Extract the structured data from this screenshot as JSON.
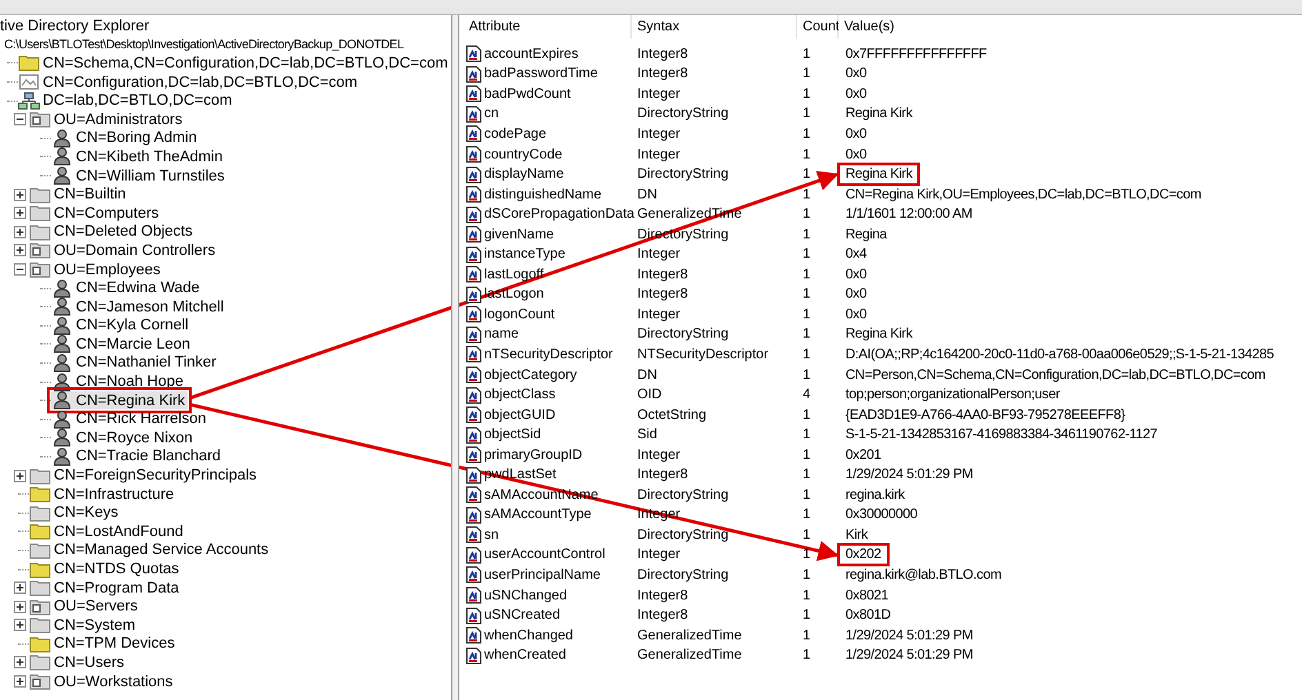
{
  "tree": {
    "label": "tive Directory Explorer",
    "children": [
      {
        "label": "C:\\Users\\BTLOTest\\Desktop\\Investigation\\ActiveDirectoryBackup_DONOTDEL",
        "children": [
          {
            "label": "CN=Schema,CN=Configuration,DC=lab,DC=BTLO,DC=com",
            "kind": "folder-yellow",
            "selected": false
          },
          {
            "label": "CN=Configuration,DC=lab,DC=BTLO,DC=com",
            "kind": "config",
            "selected": false
          },
          {
            "label": "DC=lab,DC=BTLO,DC=com",
            "kind": "domain",
            "selected": false,
            "children": [
              {
                "label": "OU=Administrators",
                "kind": "ou",
                "expanded": true,
                "selected": false,
                "children": [
                  {
                    "label": "CN=Boring Admin",
                    "kind": "user",
                    "selected": false
                  },
                  {
                    "label": "CN=Kibeth TheAdmin",
                    "kind": "user",
                    "selected": false
                  },
                  {
                    "label": "CN=William Turnstiles",
                    "kind": "user",
                    "selected": false
                  }
                ]
              },
              {
                "label": "CN=Builtin",
                "kind": "folder",
                "expanded": false,
                "selected": false
              },
              {
                "label": "CN=Computers",
                "kind": "folder",
                "expanded": false,
                "selected": false
              },
              {
                "label": "CN=Deleted Objects",
                "kind": "folder",
                "expanded": false,
                "selected": false
              },
              {
                "label": "OU=Domain Controllers",
                "kind": "ou",
                "expanded": false,
                "selected": false
              },
              {
                "label": "OU=Employees",
                "kind": "ou",
                "expanded": true,
                "selected": false,
                "children": [
                  {
                    "label": "CN=Edwina Wade",
                    "kind": "user",
                    "selected": false
                  },
                  {
                    "label": "CN=Jameson Mitchell",
                    "kind": "user",
                    "selected": false
                  },
                  {
                    "label": "CN=Kyla Cornell",
                    "kind": "user",
                    "selected": false
                  },
                  {
                    "label": "CN=Marcie Leon",
                    "kind": "user",
                    "selected": false
                  },
                  {
                    "label": "CN=Nathaniel Tinker",
                    "kind": "user",
                    "selected": false
                  },
                  {
                    "label": "CN=Noah Hope",
                    "kind": "user",
                    "selected": false
                  },
                  {
                    "label": "CN=Regina Kirk",
                    "kind": "user",
                    "selected": true,
                    "highlighted": true
                  },
                  {
                    "label": "CN=Rick Harrelson",
                    "kind": "user",
                    "selected": false
                  },
                  {
                    "label": "CN=Royce Nixon",
                    "kind": "user",
                    "selected": false
                  },
                  {
                    "label": "CN=Tracie Blanchard",
                    "kind": "user",
                    "selected": false
                  }
                ]
              },
              {
                "label": "CN=ForeignSecurityPrincipals",
                "kind": "folder",
                "expanded": false,
                "selected": false
              },
              {
                "label": "CN=Infrastructure",
                "kind": "folder-yellow",
                "selected": false
              },
              {
                "label": "CN=Keys",
                "kind": "folder",
                "selected": false
              },
              {
                "label": "CN=LostAndFound",
                "kind": "folder-yellow",
                "selected": false
              },
              {
                "label": "CN=Managed Service Accounts",
                "kind": "folder",
                "selected": false
              },
              {
                "label": "CN=NTDS Quotas",
                "kind": "folder-yellow",
                "selected": false
              },
              {
                "label": "CN=Program Data",
                "kind": "folder",
                "expanded": false,
                "selected": false
              },
              {
                "label": "OU=Servers",
                "kind": "ou",
                "expanded": false,
                "selected": false
              },
              {
                "label": "CN=System",
                "kind": "folder",
                "expanded": false,
                "selected": false
              },
              {
                "label": "CN=TPM Devices",
                "kind": "folder-yellow",
                "selected": false
              },
              {
                "label": "CN=Users",
                "kind": "folder",
                "expanded": false,
                "selected": false
              },
              {
                "label": "OU=Workstations",
                "kind": "ou",
                "expanded": false,
                "selected": false
              }
            ]
          }
        ]
      }
    ]
  },
  "table": {
    "columns": [
      "Attribute",
      "Syntax",
      "Count",
      "Value(s)"
    ],
    "rows": [
      {
        "attribute": "accountExpires",
        "syntax": "Integer8",
        "count": "1",
        "value": "0x7FFFFFFFFFFFFFFF"
      },
      {
        "attribute": "badPasswordTime",
        "syntax": "Integer8",
        "count": "1",
        "value": "0x0"
      },
      {
        "attribute": "badPwdCount",
        "syntax": "Integer",
        "count": "1",
        "value": "0x0"
      },
      {
        "attribute": "cn",
        "syntax": "DirectoryString",
        "count": "1",
        "value": "Regina Kirk"
      },
      {
        "attribute": "codePage",
        "syntax": "Integer",
        "count": "1",
        "value": "0x0"
      },
      {
        "attribute": "countryCode",
        "syntax": "Integer",
        "count": "1",
        "value": "0x0"
      },
      {
        "attribute": "displayName",
        "syntax": "DirectoryString",
        "count": "1",
        "value": "Regina Kirk",
        "highlighted": true
      },
      {
        "attribute": "distinguishedName",
        "syntax": "DN",
        "count": "1",
        "value": "CN=Regina Kirk,OU=Employees,DC=lab,DC=BTLO,DC=com"
      },
      {
        "attribute": "dSCorePropagationData",
        "syntax": "GeneralizedTime",
        "count": "1",
        "value": "1/1/1601 12:00:00 AM"
      },
      {
        "attribute": "givenName",
        "syntax": "DirectoryString",
        "count": "1",
        "value": "Regina"
      },
      {
        "attribute": "instanceType",
        "syntax": "Integer",
        "count": "1",
        "value": "0x4"
      },
      {
        "attribute": "lastLogoff",
        "syntax": "Integer8",
        "count": "1",
        "value": "0x0"
      },
      {
        "attribute": "lastLogon",
        "syntax": "Integer8",
        "count": "1",
        "value": "0x0"
      },
      {
        "attribute": "logonCount",
        "syntax": "Integer",
        "count": "1",
        "value": "0x0"
      },
      {
        "attribute": "name",
        "syntax": "DirectoryString",
        "count": "1",
        "value": "Regina Kirk"
      },
      {
        "attribute": "nTSecurityDescriptor",
        "syntax": "NTSecurityDescriptor",
        "count": "1",
        "value": "D:AI(OA;;RP;4c164200-20c0-11d0-a768-00aa006e0529;;S-1-5-21-134285"
      },
      {
        "attribute": "objectCategory",
        "syntax": "DN",
        "count": "1",
        "value": "CN=Person,CN=Schema,CN=Configuration,DC=lab,DC=BTLO,DC=com"
      },
      {
        "attribute": "objectClass",
        "syntax": "OID",
        "count": "4",
        "value": "top;person;organizationalPerson;user"
      },
      {
        "attribute": "objectGUID",
        "syntax": "OctetString",
        "count": "1",
        "value": "{EAD3D1E9-A766-4AA0-BF93-795278EEEFF8}"
      },
      {
        "attribute": "objectSid",
        "syntax": "Sid",
        "count": "1",
        "value": "S-1-5-21-1342853167-4169883384-3461190762-1127"
      },
      {
        "attribute": "primaryGroupID",
        "syntax": "Integer",
        "count": "1",
        "value": "0x201"
      },
      {
        "attribute": "pwdLastSet",
        "syntax": "Integer8",
        "count": "1",
        "value": "1/29/2024 5:01:29 PM"
      },
      {
        "attribute": "sAMAccountName",
        "syntax": "DirectoryString",
        "count": "1",
        "value": "regina.kirk"
      },
      {
        "attribute": "sAMAccountType",
        "syntax": "Integer",
        "count": "1",
        "value": "0x30000000"
      },
      {
        "attribute": "sn",
        "syntax": "DirectoryString",
        "count": "1",
        "value": "Kirk"
      },
      {
        "attribute": "userAccountControl",
        "syntax": "Integer",
        "count": "1",
        "value": "0x202",
        "highlighted": true
      },
      {
        "attribute": "userPrincipalName",
        "syntax": "DirectoryString",
        "count": "1",
        "value": "regina.kirk@lab.BTLO.com"
      },
      {
        "attribute": "uSNChanged",
        "syntax": "Integer8",
        "count": "1",
        "value": "0x8021"
      },
      {
        "attribute": "uSNCreated",
        "syntax": "Integer8",
        "count": "1",
        "value": "0x801D"
      },
      {
        "attribute": "whenChanged",
        "syntax": "GeneralizedTime",
        "count": "1",
        "value": "1/29/2024 5:01:29 PM"
      },
      {
        "attribute": "whenCreated",
        "syntax": "GeneralizedTime",
        "count": "1",
        "value": "1/29/2024 5:01:29 PM"
      }
    ]
  }
}
